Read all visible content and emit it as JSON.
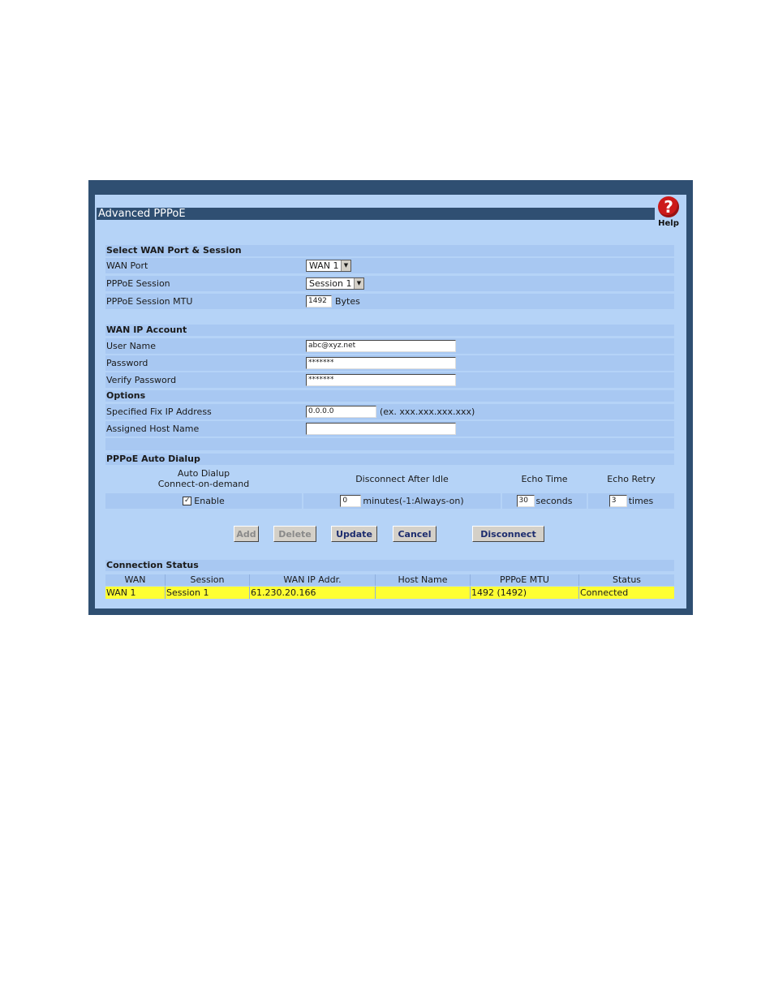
{
  "window": {
    "title": "Advanced PPPoE",
    "help_label": "Help",
    "help_glyph": "?"
  },
  "wan_section": {
    "header": "Select WAN Port & Session",
    "wan_port_label": "WAN Port",
    "wan_port_value": "WAN 1",
    "session_label": "PPPoE Session",
    "session_value": "Session 1",
    "mtu_label": "PPPoE Session MTU",
    "mtu_value": "1492",
    "mtu_unit": "Bytes"
  },
  "account": {
    "header": "WAN IP Account",
    "user_label": "User Name",
    "user_value": "abc@xyz.net",
    "pass_label": "Password",
    "pass_value": "*******",
    "verify_label": "Verify Password",
    "verify_value": "*******"
  },
  "options": {
    "header": "Options",
    "ip_label": "Specified Fix IP Address",
    "ip_value": "0.0.0.0",
    "ip_hint": "(ex. xxx.xxx.xxx.xxx)",
    "host_label": "Assigned Host Name",
    "host_value": ""
  },
  "dialup": {
    "header": "PPPoE Auto Dialup",
    "col_auto_1": "Auto Dialup",
    "col_auto_2": "Connect-on-demand",
    "col_idle": "Disconnect After Idle",
    "col_echo_time": "Echo Time",
    "col_echo_retry": "Echo Retry",
    "enable_label": "Enable",
    "enable_checked": true,
    "check_glyph": "✓",
    "idle_value": "0",
    "idle_unit": "minutes(-1:Always-on)",
    "echo_time_value": "30",
    "echo_time_unit": "seconds",
    "echo_retry_value": "3",
    "echo_retry_unit": "times"
  },
  "buttons": {
    "add": "Add",
    "delete": "Delete",
    "update": "Update",
    "cancel": "Cancel",
    "disconnect": "Disconnect"
  },
  "status": {
    "header": "Connection Status",
    "columns": [
      "WAN",
      "Session",
      "WAN IP Addr.",
      "Host Name",
      "PPPoE MTU",
      "Status"
    ],
    "rows": [
      [
        "WAN 1",
        "Session 1",
        "61.230.20.166",
        "",
        "1492 (1492)",
        "Connected"
      ]
    ]
  },
  "colors": {
    "frame": "#2f4f72",
    "panel": "#b5d3f7",
    "row": "#a8c8f2",
    "highlight": "#ffff33"
  }
}
